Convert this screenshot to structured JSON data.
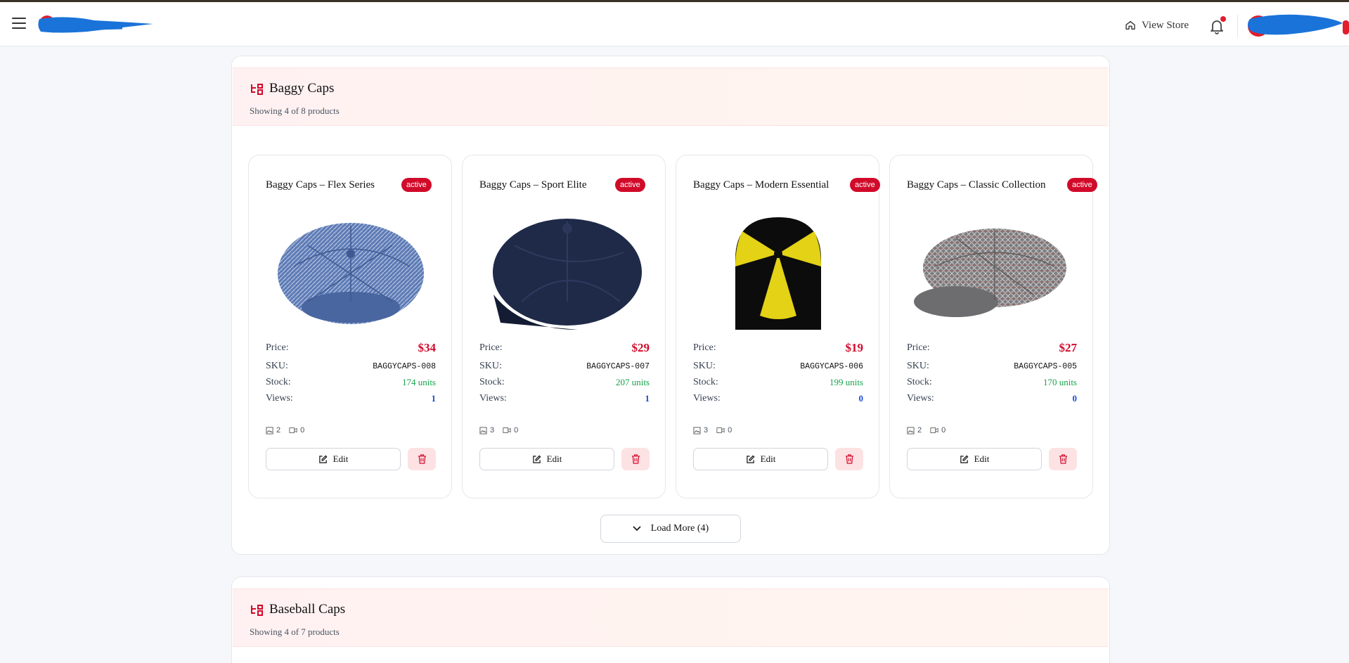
{
  "header": {
    "view_store_label": "View Store"
  },
  "sections": [
    {
      "title": "Baggy Caps",
      "subtitle": "Showing 4 of 8 products",
      "load_more_label": "Load More (4)",
      "products": [
        {
          "name": "Baggy Caps – Flex Series",
          "status": "active",
          "price_label": "Price:",
          "price": "$34",
          "sku_label": "SKU:",
          "sku": "BAGGYCAPS-008",
          "stock_label": "Stock:",
          "stock": "174 units",
          "views_label": "Views:",
          "views": "1",
          "images": "2",
          "videos": "0",
          "edit_label": "Edit"
        },
        {
          "name": "Baggy Caps – Sport Elite",
          "status": "active",
          "price_label": "Price:",
          "price": "$29",
          "sku_label": "SKU:",
          "sku": "BAGGYCAPS-007",
          "stock_label": "Stock:",
          "stock": "207 units",
          "views_label": "Views:",
          "views": "1",
          "images": "3",
          "videos": "0",
          "edit_label": "Edit"
        },
        {
          "name": "Baggy Caps – Modern Essential",
          "status": "active",
          "price_label": "Price:",
          "price": "$19",
          "sku_label": "SKU:",
          "sku": "BAGGYCAPS-006",
          "stock_label": "Stock:",
          "stock": "199 units",
          "views_label": "Views:",
          "views": "0",
          "images": "3",
          "videos": "0",
          "edit_label": "Edit"
        },
        {
          "name": "Baggy Caps – Classic Collection",
          "status": "active",
          "price_label": "Price:",
          "price": "$27",
          "sku_label": "SKU:",
          "sku": "BAGGYCAPS-005",
          "stock_label": "Stock:",
          "stock": "170 units",
          "views_label": "Views:",
          "views": "0",
          "images": "2",
          "videos": "0",
          "edit_label": "Edit"
        }
      ]
    },
    {
      "title": "Baseball Caps",
      "subtitle": "Showing 4 of 7 products"
    }
  ],
  "colors": {
    "accent": "#d10a2a",
    "stock_green": "#16a34a",
    "views_blue": "#1d4ed8"
  }
}
